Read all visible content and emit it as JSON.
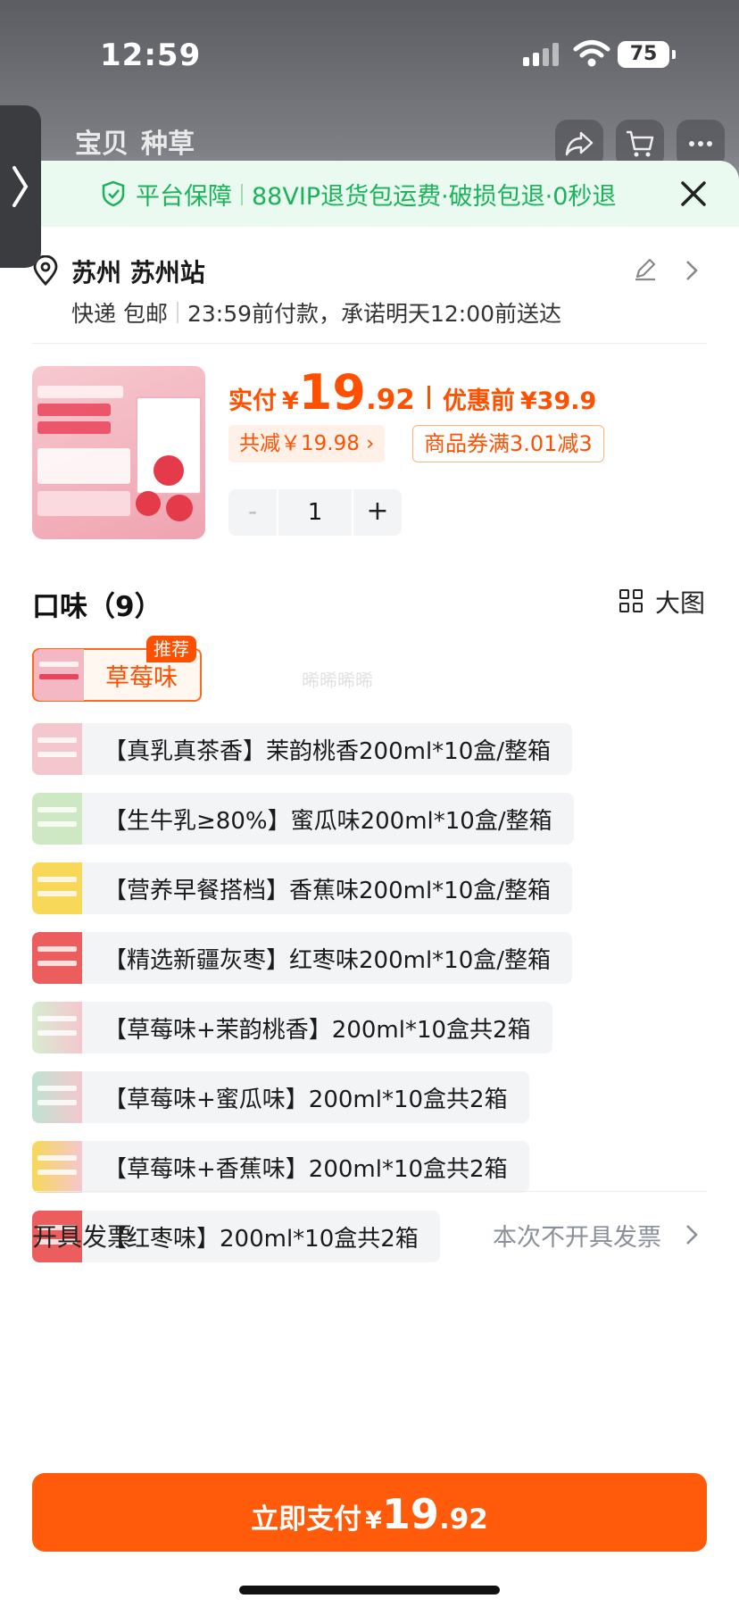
{
  "status": {
    "time": "12:59",
    "battery": "75"
  },
  "nav": {
    "tab1": "宝贝",
    "tab2": "种草"
  },
  "banner": {
    "label": "平台保障",
    "text": "88VIP退货包运费·破损包退·0秒退"
  },
  "address": {
    "name": "苏州 苏州站",
    "method": "快递 包邮",
    "delivery": "23:59前付款，承诺明天12:00前送达"
  },
  "price": {
    "paid_label": "实付",
    "currency": "¥",
    "int": "19",
    "dec": ".92",
    "before_label": "优惠前",
    "before_value": "¥39.9"
  },
  "discount": {
    "total": "共减￥19.98 ›",
    "coupon": "商品券满3.01减3"
  },
  "stepper": {
    "minus": "-",
    "qty": "1",
    "plus": "+"
  },
  "flavor": {
    "title": "口味（9）",
    "bigview": "大图",
    "recommend_tag": "推荐",
    "selected": "草莓味"
  },
  "options": [
    {
      "label": "【真乳真茶香】茉韵桃香200ml*10盒/整箱"
    },
    {
      "label": "【生牛乳≥80%】蜜瓜味200ml*10盒/整箱"
    },
    {
      "label": "【营养早餐搭档】香蕉味200ml*10盒/整箱"
    },
    {
      "label": "【精选新疆灰枣】红枣味200ml*10盒/整箱"
    },
    {
      "label": "【草莓味+茉韵桃香】200ml*10盒共2箱"
    },
    {
      "label": "【草莓味+蜜瓜味】200ml*10盒共2箱"
    },
    {
      "label": "【草莓味+香蕉味】200ml*10盒共2箱"
    },
    {
      "label": "【红枣味】200ml*10盒共2箱"
    }
  ],
  "watermark": "晞晞晞晞",
  "invoice": {
    "label": "开具发票",
    "value": "本次不开具发票"
  },
  "pay": {
    "label": "立即支付",
    "currency": "¥",
    "int": "19",
    "dec": ".92"
  },
  "colors": {
    "accent": "#ff5000",
    "guarantee": "#1bb35a"
  }
}
